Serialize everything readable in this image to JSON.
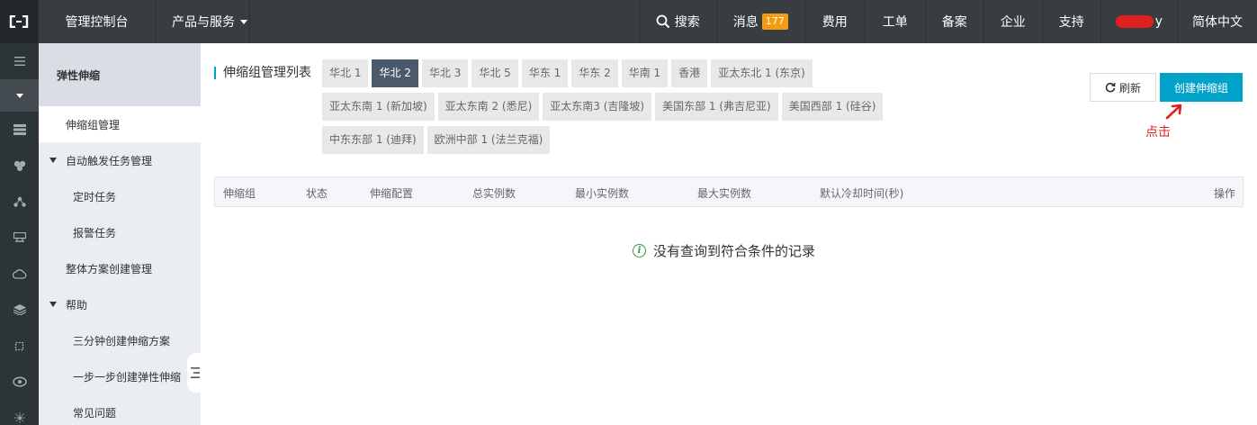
{
  "topbar": {
    "console": "管理控制台",
    "products": "产品与服务",
    "search": "搜索",
    "messages": "消息",
    "message_count": "177",
    "billing": "费用",
    "tickets": "工单",
    "filing": "备案",
    "enterprise": "企业",
    "support": "支持",
    "user_suffix": "y",
    "language": "简体中文"
  },
  "sidebar": {
    "title": "弹性伸缩",
    "items": {
      "scaling_group_mgmt": "伸缩组管理",
      "auto_trigger": "自动触发任务管理",
      "scheduled": "定时任务",
      "alarm": "报警任务",
      "solution_create": "整体方案创建管理",
      "help": "帮助",
      "three_min": "三分钟创建伸缩方案",
      "step_by_step": "一步一步创建弹性伸缩",
      "faq": "常见问题"
    }
  },
  "main": {
    "list_title": "伸缩组管理列表",
    "regions": [
      "华北 1",
      "华北 2",
      "华北 3",
      "华北 5",
      "华东 1",
      "华东 2",
      "华南 1",
      "香港",
      "亚太东北 1 (东京)",
      "亚太东南 1 (新加坡)",
      "亚太东南 2 (悉尼)",
      "亚太东南3 (吉隆坡)",
      "美国东部 1 (弗吉尼亚)",
      "美国西部 1 (硅谷)",
      "中东东部 1 (迪拜)",
      "欧洲中部 1 (法兰克福)"
    ],
    "selected_region": "华北 2",
    "refresh": "刷新",
    "create": "创建伸缩组",
    "annotation": "点击",
    "columns": [
      "伸缩组",
      "状态",
      "伸缩配置",
      "总实例数",
      "最小实例数",
      "最大实例数",
      "默认冷却时间(秒)",
      "操作"
    ],
    "empty_message": "没有查询到符合条件的记录"
  },
  "colors": {
    "accent": "#00a2ca",
    "topbar": "#373d41",
    "badge": "#f39c12",
    "annotation": "#e02020",
    "info": "#2e9d3a"
  }
}
